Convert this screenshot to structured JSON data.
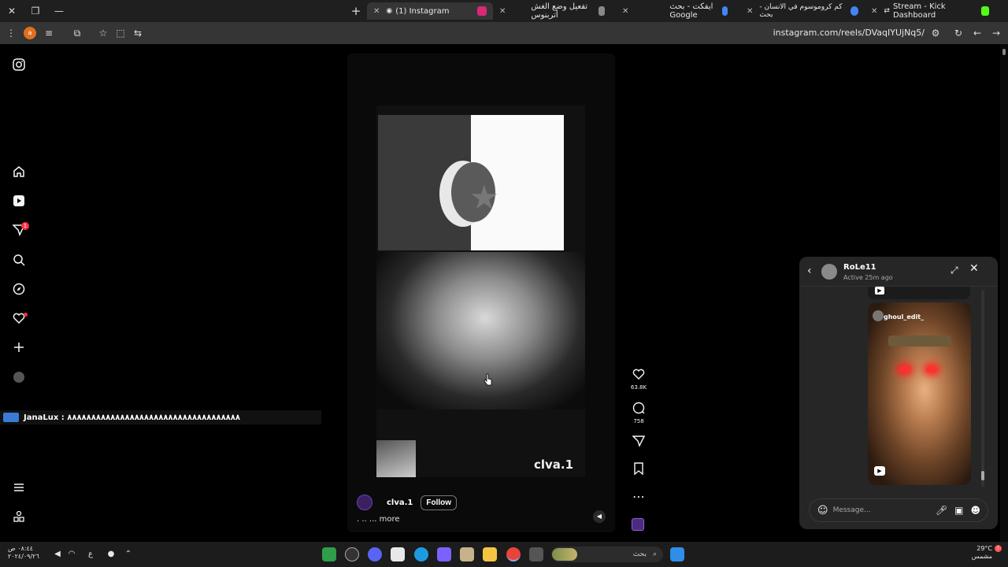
{
  "browser": {
    "tabs": [
      {
        "label": "Stream - Kick Dashboard",
        "favicon_color": "#53fc18",
        "active": false
      },
      {
        "label": "كم كروموسوم في الانسان - بحث",
        "favicon_color": "#4285f4",
        "active": false
      },
      {
        "label": "ايفكت - بحث Google",
        "favicon_color": "#4285f4",
        "active": false
      },
      {
        "label": "تفعيل وضع الغش أتربنوس",
        "favicon_color": "#888888",
        "active": false
      },
      {
        "label": "(1) Instagram",
        "favicon_color": "#d62976",
        "active": true
      }
    ],
    "url": "instagram.com/reels/DVaqIYUjNq5/"
  },
  "stream_overlay": {
    "chat_line": "JanaLux : ٨٨٨٨٨٨٨٨٨٨٨٨٨٨٨٨٨٨٨٨٨٨٨٨٨٨٨٨٨٨٨٨٨٨٨٨"
  },
  "sidebar": {
    "notification_count": "1",
    "icons": [
      "instagram-logo",
      "home",
      "reels",
      "messages",
      "search",
      "explore",
      "notifications",
      "create",
      "profile",
      "more",
      "meta"
    ]
  },
  "reel": {
    "watermark": "clva.1",
    "author": "clva.1",
    "follow_label": "Follow",
    "caption": ". .. ... more",
    "likes": "63.8K",
    "comments": "758"
  },
  "chat": {
    "name": "RoLe11",
    "status": "Active 25m ago",
    "shared_user": "ghoul_edit_",
    "message_placeholder": "Message..."
  },
  "taskbar": {
    "time": "٠٨:٤٤ ص",
    "date": "٢٠٢٤/٠٩/٢٦",
    "lang": "ع",
    "search_placeholder": "بحث",
    "temp": "29°C",
    "weather": "مشمس"
  },
  "colors": {
    "ig_bg": "#000000",
    "chat_bg": "#262626",
    "notification_red": "#ff3040"
  }
}
